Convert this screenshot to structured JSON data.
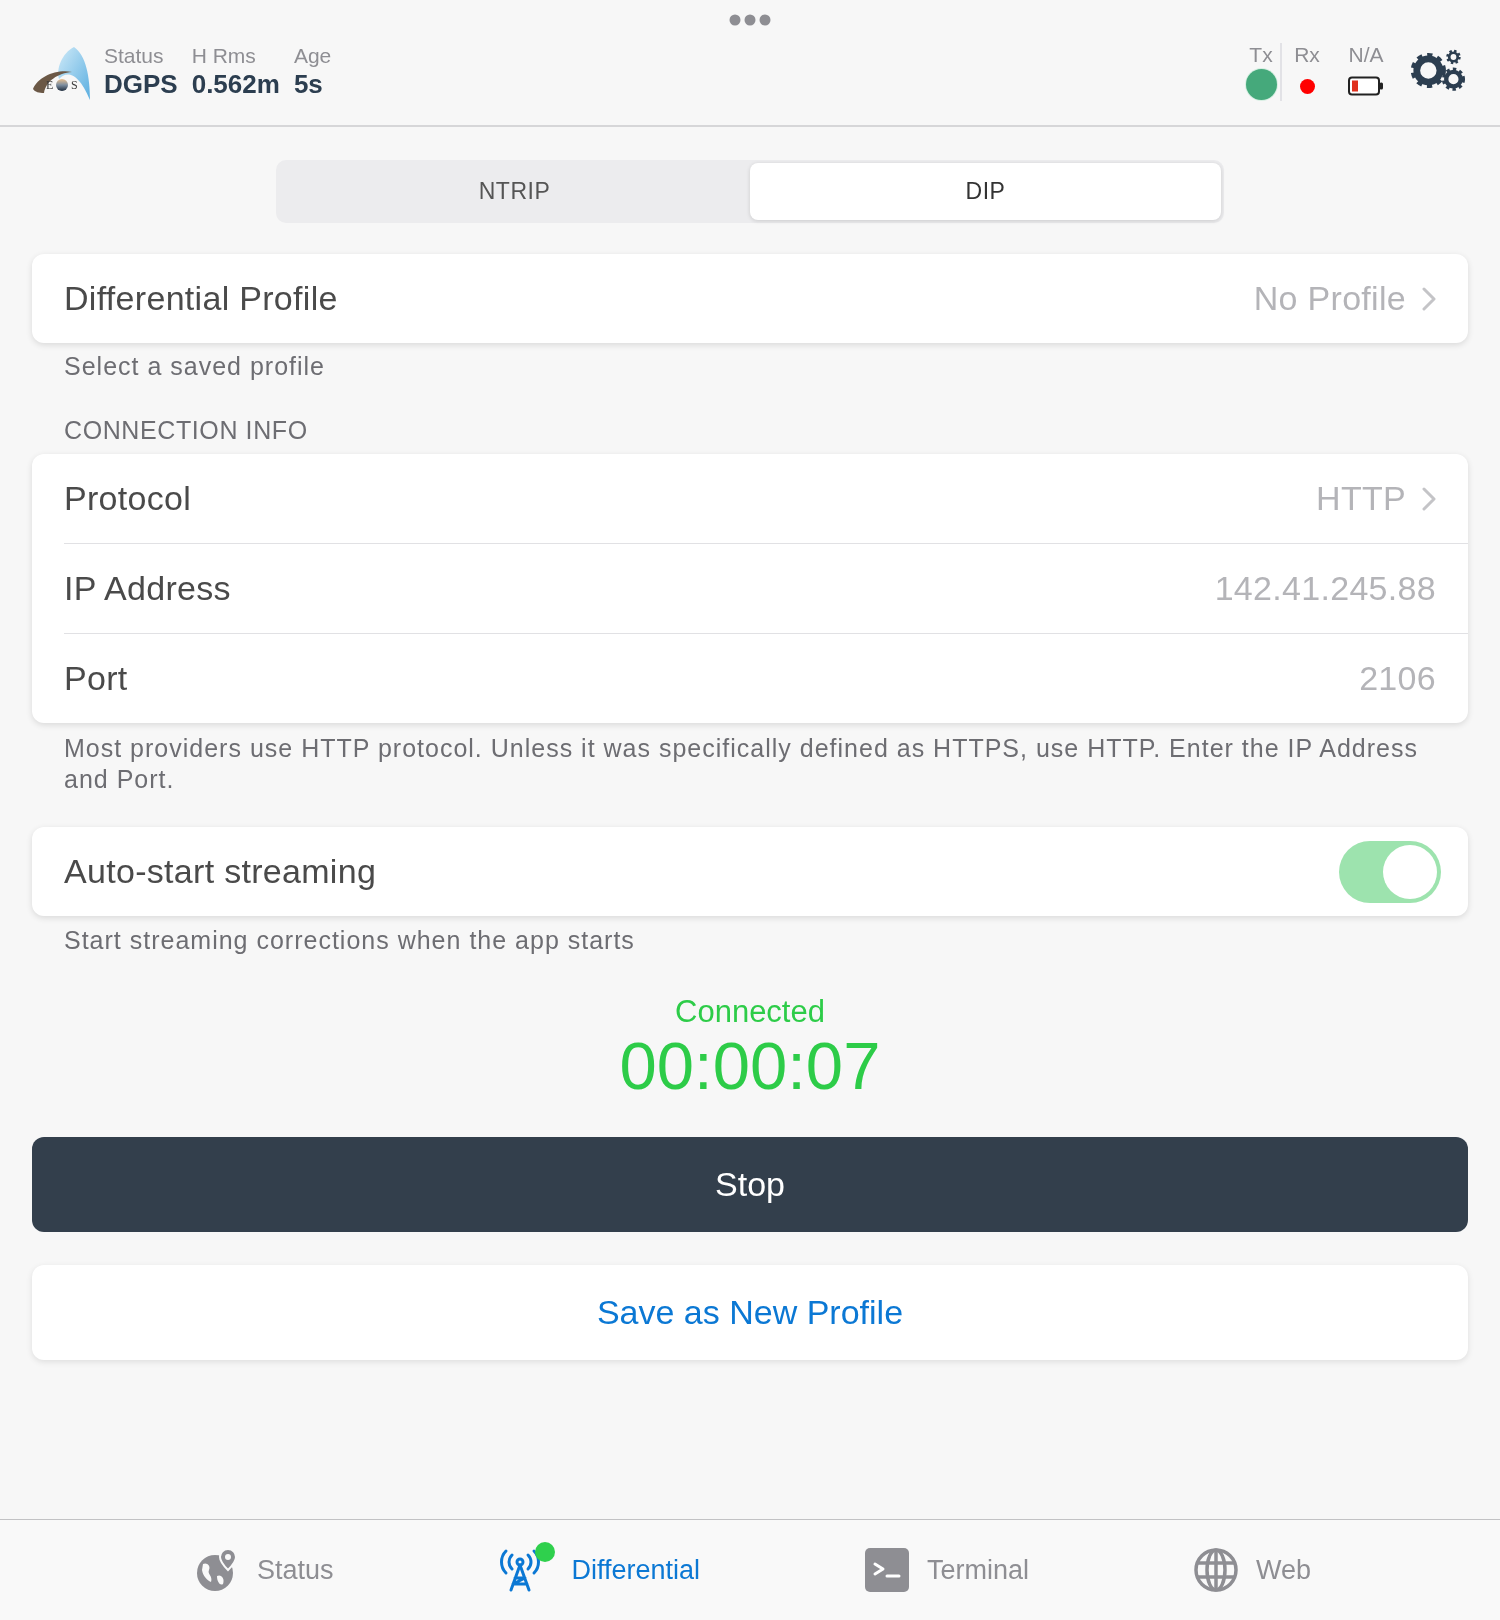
{
  "header": {
    "logo": {
      "letters": [
        "E",
        "S"
      ]
    },
    "stats": [
      {
        "label": "Status",
        "value": "DGPS"
      },
      {
        "label": "H Rms",
        "value": "0.562m"
      },
      {
        "label": "Age",
        "value": "5s"
      }
    ],
    "indicators": [
      {
        "label": "Tx",
        "kind": "led",
        "color": "#45a97b"
      },
      {
        "label": "Rx",
        "kind": "dot",
        "color": "#ff0000"
      },
      {
        "label": "N/A",
        "kind": "battery"
      }
    ]
  },
  "tabs": [
    {
      "label": "NTRIP",
      "selected": false
    },
    {
      "label": "DIP",
      "selected": true
    }
  ],
  "profile": {
    "row": {
      "label": "Differential Profile",
      "value": "No Profile",
      "kind": "picker"
    },
    "footer": "Select a saved profile"
  },
  "connection": {
    "header": "CONNECTION INFO",
    "rows": [
      {
        "label": "Protocol",
        "value": "HTTP",
        "kind": "picker"
      },
      {
        "label": "IP Address",
        "value": "142.41.245.88",
        "kind": "field"
      },
      {
        "label": "Port",
        "value": "2106",
        "kind": "field"
      }
    ],
    "footer": "Most providers use HTTP protocol. Unless it was specifically defined as HTTPS, use HTTP. Enter the IP Address and Port."
  },
  "auto_start": {
    "label": "Auto-start streaming",
    "on": true,
    "footer": "Start streaming corrections when the app starts"
  },
  "session": {
    "state": "Connected",
    "elapsed": "00:00:07"
  },
  "buttons": [
    {
      "label": "Stop",
      "kind": "stop"
    },
    {
      "label": "Save as New Profile",
      "kind": "save"
    }
  ],
  "tab_bar": [
    {
      "label": "Status",
      "kind": "globe-pin",
      "selected": false,
      "badge": false
    },
    {
      "label": "Differential",
      "kind": "antenna",
      "selected": true,
      "badge": true
    },
    {
      "label": "Terminal",
      "kind": "terminal",
      "selected": false,
      "badge": false
    },
    {
      "label": "Web",
      "kind": "globe",
      "selected": false,
      "badge": false
    }
  ]
}
